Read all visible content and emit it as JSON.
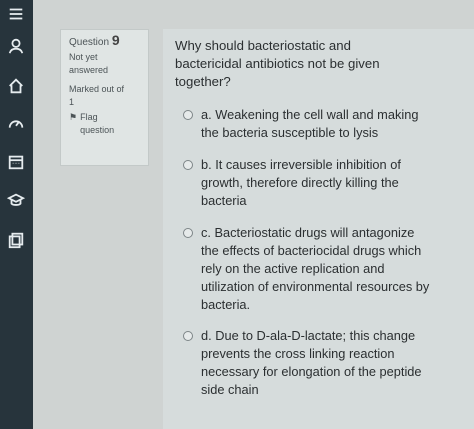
{
  "sidebar": {
    "icons": [
      "list-icon",
      "user-circle-icon",
      "home-icon",
      "gauge-icon",
      "calendar-icon",
      "graduation-cap-icon",
      "file-copy-icon"
    ]
  },
  "info": {
    "question_label": "Question",
    "question_number": "9",
    "status": "Not yet answered",
    "marked_out_of": "Marked out of",
    "marked_value": "1",
    "flag_label": "Flag question"
  },
  "question": {
    "text": "Why should bacteriostatic and bactericidal antibiotics not be given together?",
    "options": [
      {
        "label": "a. Weakening the cell wall and making the bacteria susceptible to lysis"
      },
      {
        "label": "b. It causes irreversible inhibition of growth, therefore directly killing the bacteria"
      },
      {
        "label": "c. Bacteriostatic drugs will antagonize the effects of bacteriocidal drugs which rely on the active replication and utilization of environmental resources by bacteria."
      },
      {
        "label": "d. Due to D-ala-D-lactate; this change prevents the cross linking reaction necessary for elongation of the peptide side chain"
      }
    ]
  },
  "colors": {
    "sidebar": "#27343c",
    "panel": "#d6dcdc",
    "info_box": "#e0e5e4"
  }
}
